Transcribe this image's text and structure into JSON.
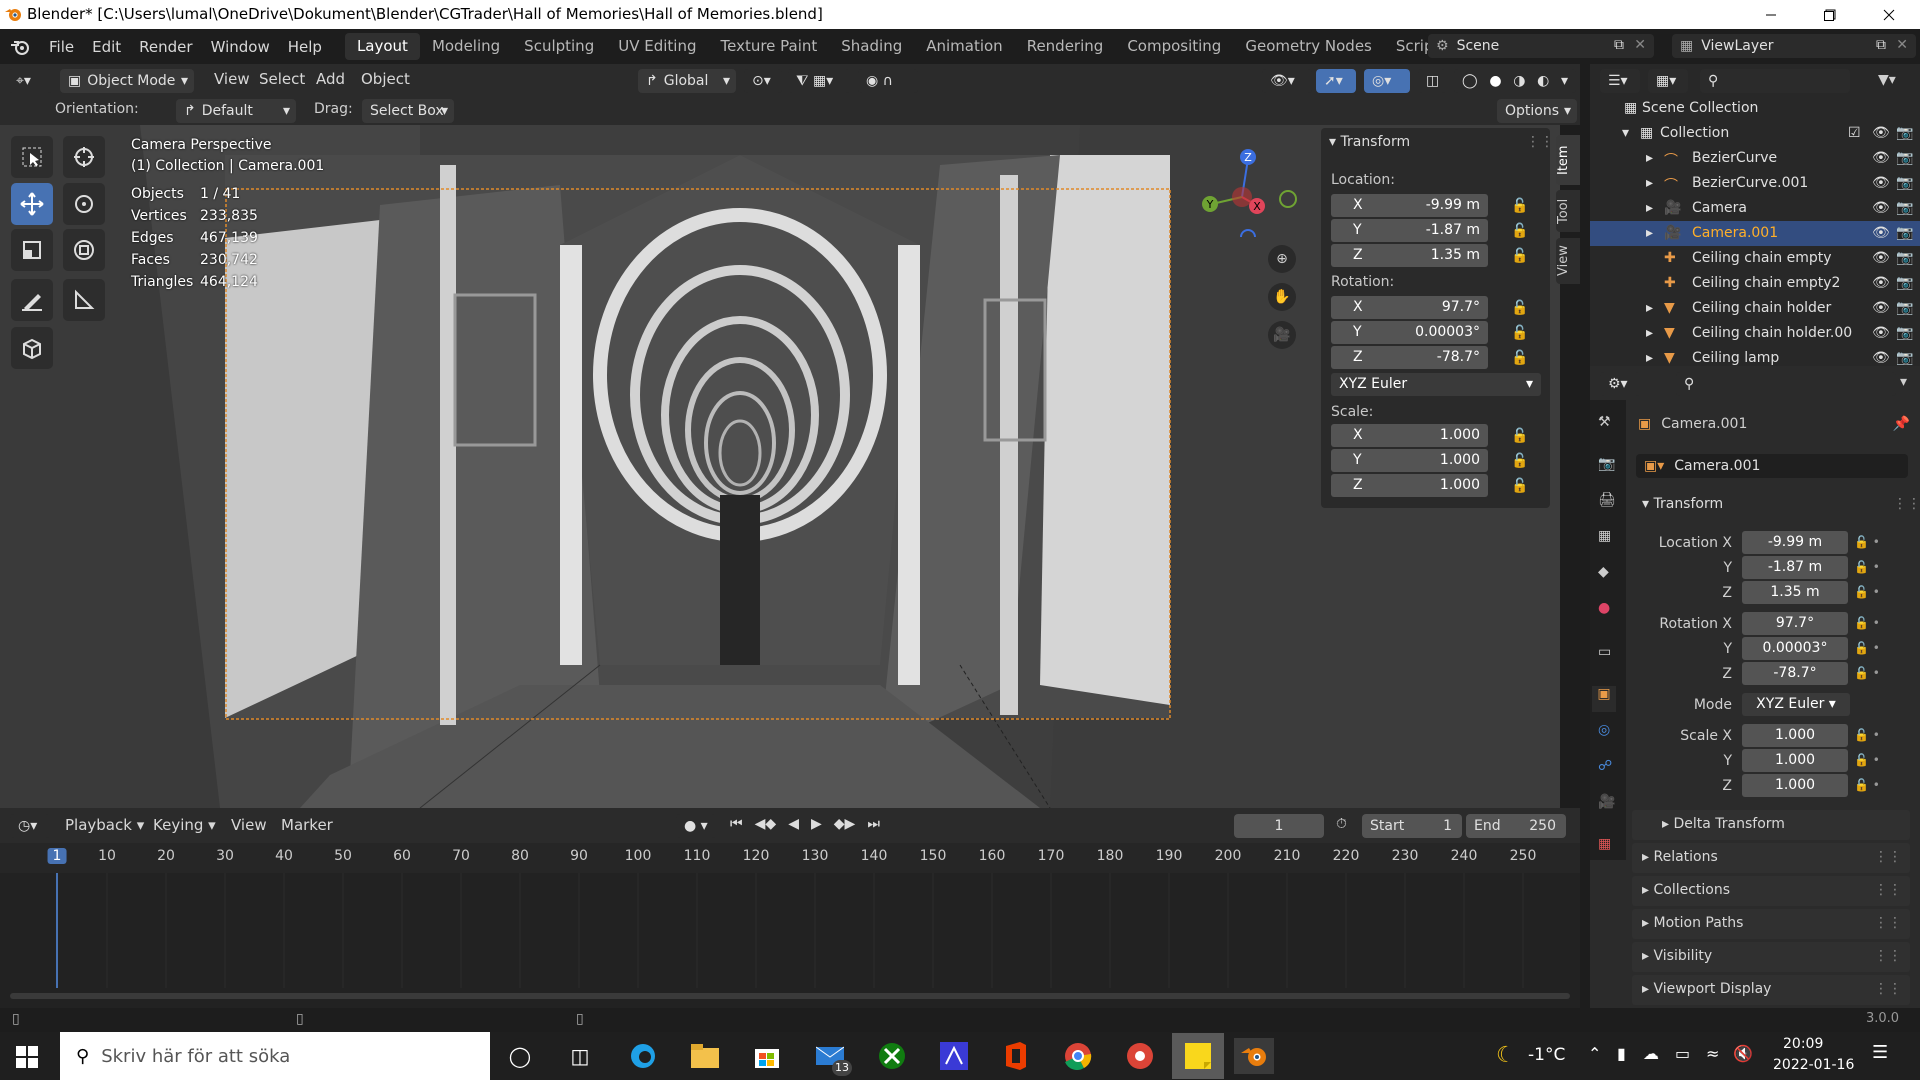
{
  "titlebar": {
    "title": "Blender* [C:\\Users\\lumal\\OneDrive\\Dokument\\Blender\\CGTrader\\Hall of Memories\\Hall of Memories.blend]"
  },
  "menu": [
    "File",
    "Edit",
    "Render",
    "Window",
    "Help"
  ],
  "workspaces": [
    "Layout",
    "Modeling",
    "Sculpting",
    "UV Editing",
    "Texture Paint",
    "Shading",
    "Animation",
    "Rendering",
    "Compositing",
    "Geometry Nodes",
    "Scripting"
  ],
  "scene": {
    "name": "Scene",
    "view_layer": "ViewLayer"
  },
  "viewport_header": {
    "mode": "Object Mode",
    "view": "View",
    "select": "Select",
    "add": "Add",
    "object": "Object",
    "transform_orientation": "Global"
  },
  "tool_settings": {
    "orientation_label": "Orientation:",
    "orientation": "Default",
    "drag_label": "Drag:",
    "drag": "Select Box",
    "options": "Options"
  },
  "overlay": {
    "title": "Camera Perspective",
    "subtitle": "(1) Collection | Camera.001"
  },
  "stats": [
    {
      "label": "Objects",
      "value": "1 / 41"
    },
    {
      "label": "Vertices",
      "value": "233,835"
    },
    {
      "label": "Edges",
      "value": "467,139"
    },
    {
      "label": "Faces",
      "value": "230,742"
    },
    {
      "label": "Triangles",
      "value": "464,124"
    }
  ],
  "npanel": {
    "header": "Transform",
    "location_label": "Location:",
    "location": [
      {
        "axis": "X",
        "value": "-9.99 m"
      },
      {
        "axis": "Y",
        "value": "-1.87 m"
      },
      {
        "axis": "Z",
        "value": "1.35 m"
      }
    ],
    "rotation_label": "Rotation:",
    "rotation": [
      {
        "axis": "X",
        "value": "97.7°"
      },
      {
        "axis": "Y",
        "value": "0.00003°"
      },
      {
        "axis": "Z",
        "value": "-78.7°"
      }
    ],
    "mode": "XYZ Euler",
    "scale_label": "Scale:",
    "scale": [
      {
        "axis": "X",
        "value": "1.000"
      },
      {
        "axis": "Y",
        "value": "1.000"
      },
      {
        "axis": "Z",
        "value": "1.000"
      }
    ],
    "tabs": [
      "Item",
      "Tool",
      "View"
    ]
  },
  "gizmo": {
    "x": "X",
    "y": "Y",
    "z": "Z"
  },
  "outliner": {
    "scene_collection": "Scene Collection",
    "collection": "Collection",
    "items": [
      "BezierCurve",
      "BezierCurve.001",
      "Camera",
      "Camera.001",
      "Ceiling chain empty",
      "Ceiling chain empty2",
      "Ceiling chain holder",
      "Ceiling chain holder.00",
      "Ceiling lamp"
    ]
  },
  "properties": {
    "object_name": "Camera.001",
    "data_name": "Camera.001",
    "transform_header": "Transform",
    "location_label": "Location X",
    "location": [
      "-9.99 m",
      "-1.87 m",
      "1.35 m"
    ],
    "rotation_label": "Rotation X",
    "rotation": [
      "97.7°",
      "0.00003°",
      "-78.7°"
    ],
    "axis_y": "Y",
    "axis_z": "Z",
    "mode_label": "Mode",
    "mode": "XYZ Euler",
    "scale_label": "Scale X",
    "scale": [
      "1.000",
      "1.000",
      "1.000"
    ],
    "sections": [
      "Delta Transform",
      "Relations",
      "Collections",
      "Motion Paths",
      "Visibility",
      "Viewport Display"
    ]
  },
  "timeline": {
    "playback": "Playback",
    "keying": "Keying",
    "view": "View",
    "marker": "Marker",
    "current_frame": "1",
    "start_label": "Start",
    "start": "1",
    "end_label": "End",
    "end": "250",
    "ticks": [
      "1",
      "10",
      "20",
      "30",
      "40",
      "50",
      "60",
      "70",
      "80",
      "90",
      "100",
      "110",
      "120",
      "130",
      "140",
      "150",
      "160",
      "170",
      "180",
      "190",
      "200",
      "210",
      "220",
      "230",
      "240",
      "250"
    ]
  },
  "statusbar": {
    "version": "3.0.0"
  },
  "taskbar": {
    "search_placeholder": "Skriv här för att söka",
    "mail_badge": "13",
    "temperature": "-1°C",
    "time": "20:09",
    "date": "2022-01-16"
  }
}
